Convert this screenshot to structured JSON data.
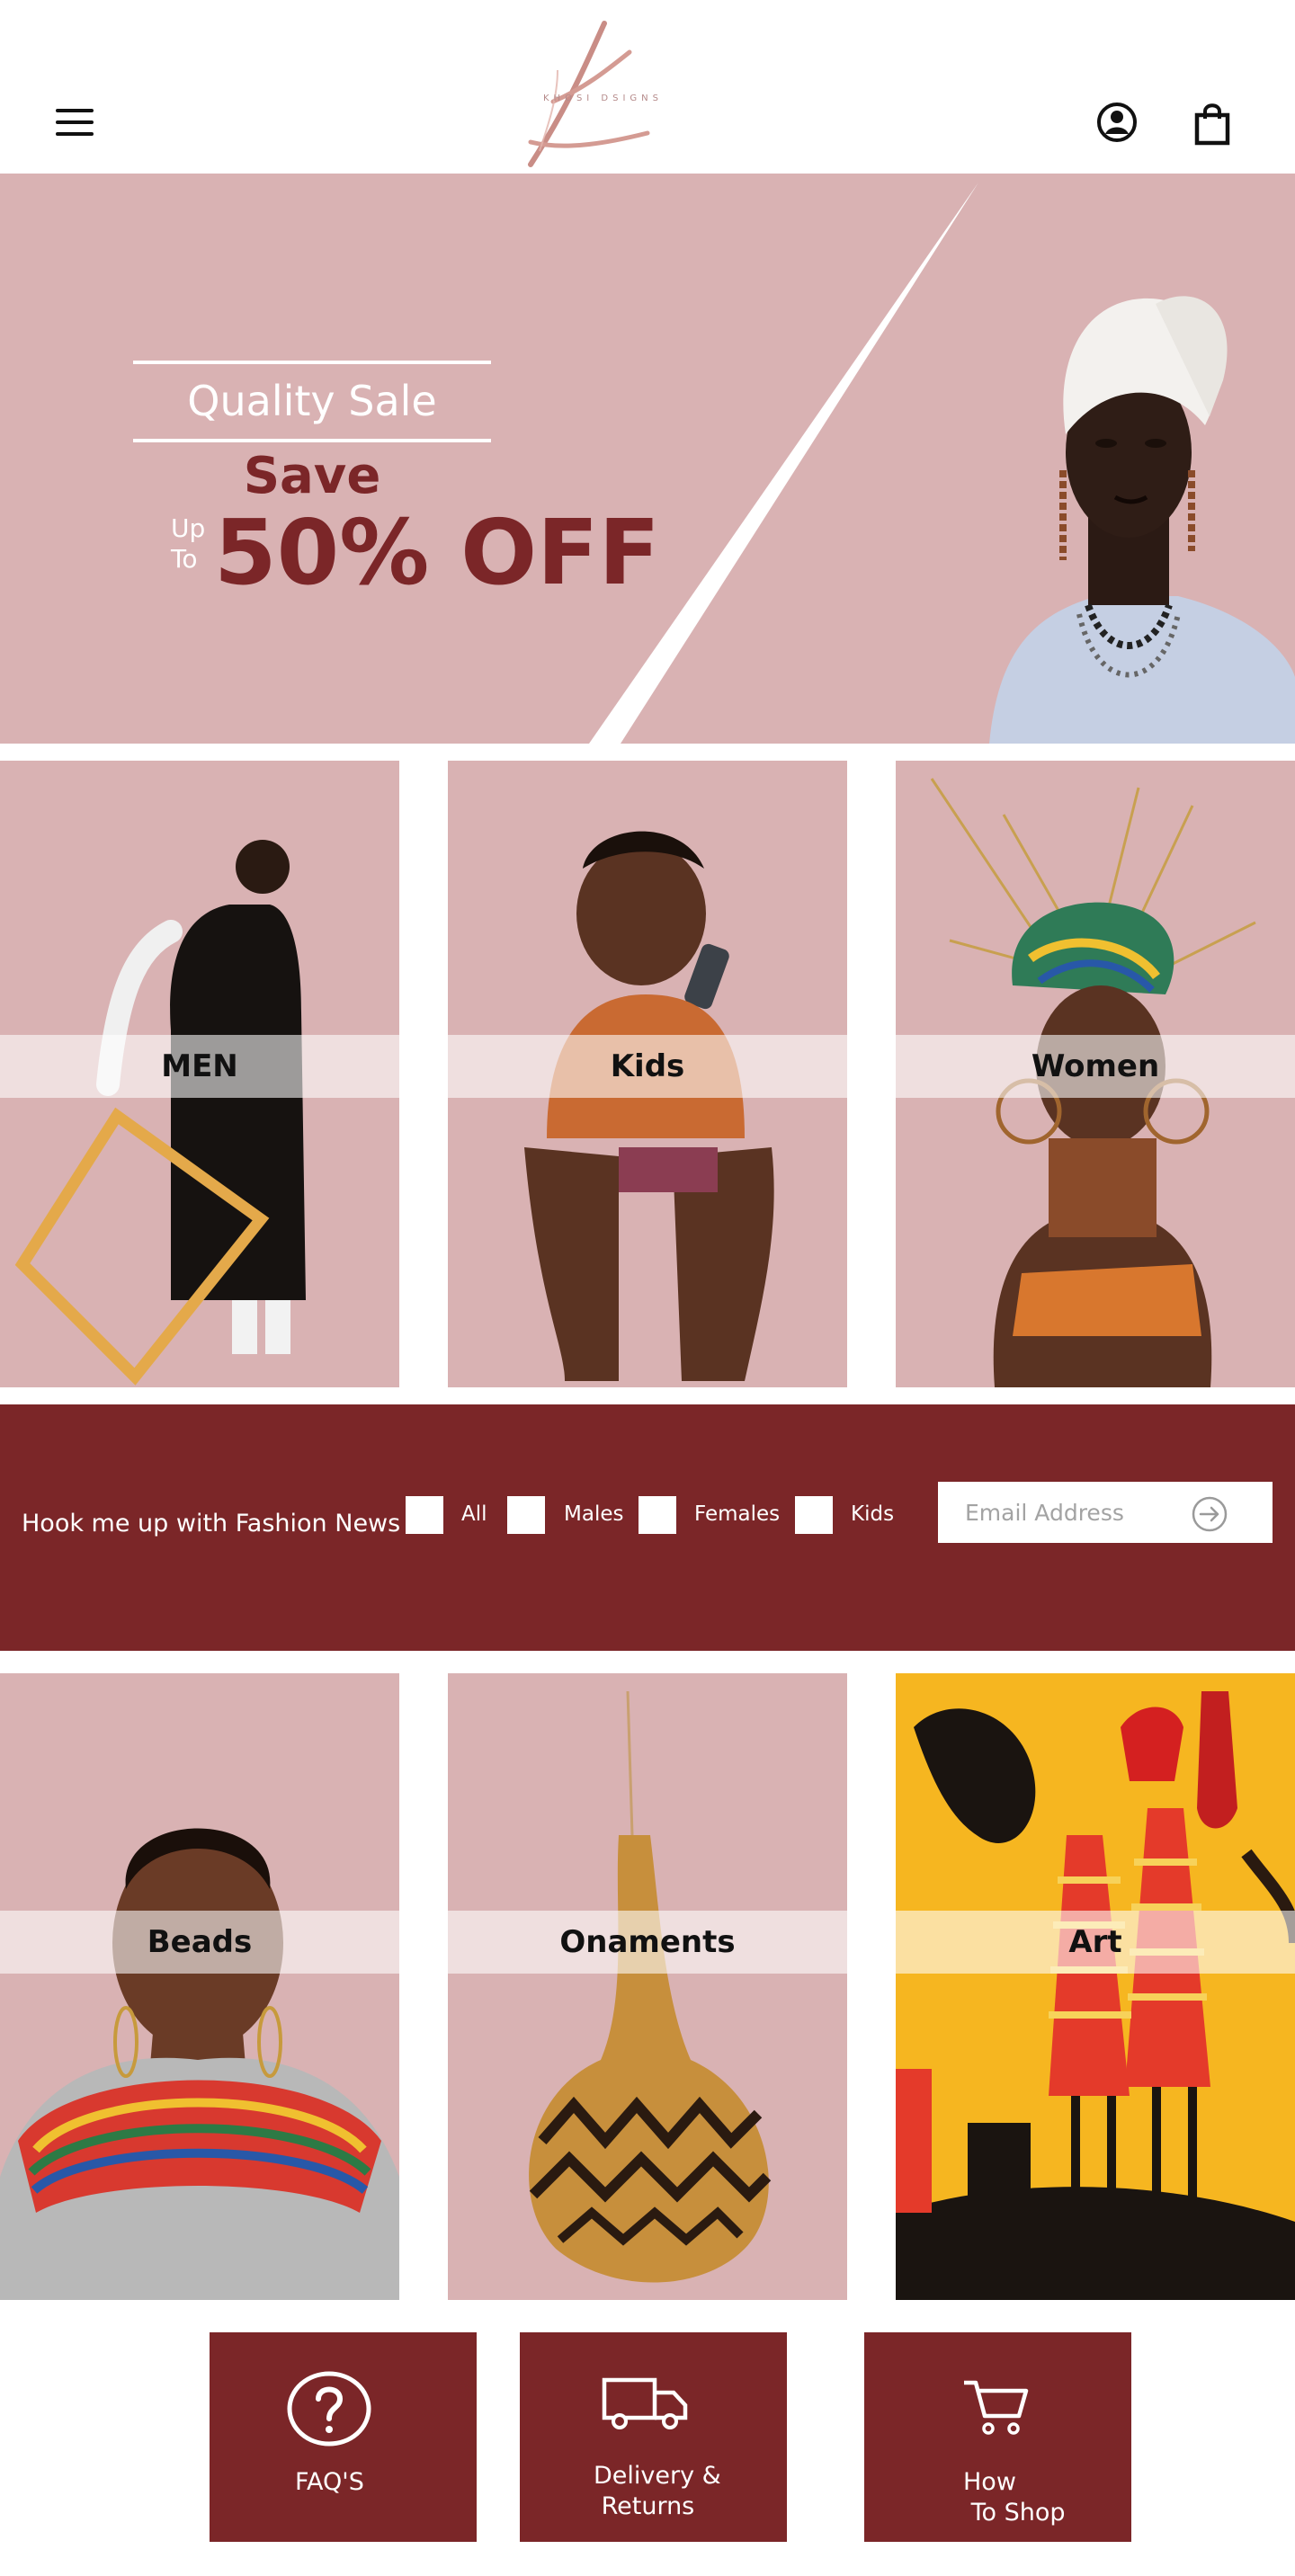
{
  "header": {
    "logo_text": "KHOSI DSIGNS",
    "menu_icon": "hamburger-menu-icon",
    "account_icon": "user-circle-icon",
    "cart_icon": "shopping-bag-icon"
  },
  "hero": {
    "title": "Quality Sale",
    "save": "Save",
    "up": "Up",
    "to": "To",
    "discount": "50% OFF"
  },
  "categories": [
    {
      "label": "MEN"
    },
    {
      "label": "Kids"
    },
    {
      "label": "Women"
    }
  ],
  "newsletter": {
    "title": "Hook me up with Fashion News",
    "options": [
      "All",
      "Males",
      "Females",
      "Kids"
    ],
    "email_placeholder": "Email Address",
    "submit_icon": "arrow-right-circle-icon"
  },
  "products": [
    {
      "label": "Beads"
    },
    {
      "label": "Onaments"
    },
    {
      "label": "Art"
    }
  ],
  "footer_links": [
    {
      "label": "FAQ'S",
      "icon": "question-circle-icon"
    },
    {
      "label": "Delivery &\n Returns",
      "icon": "delivery-truck-icon"
    },
    {
      "label": "How\n To Shop",
      "icon": "shopping-cart-icon"
    }
  ],
  "colors": {
    "brand_maroon": "#7b2628",
    "tile_pink": "#d9b2b3",
    "white": "#ffffff"
  }
}
